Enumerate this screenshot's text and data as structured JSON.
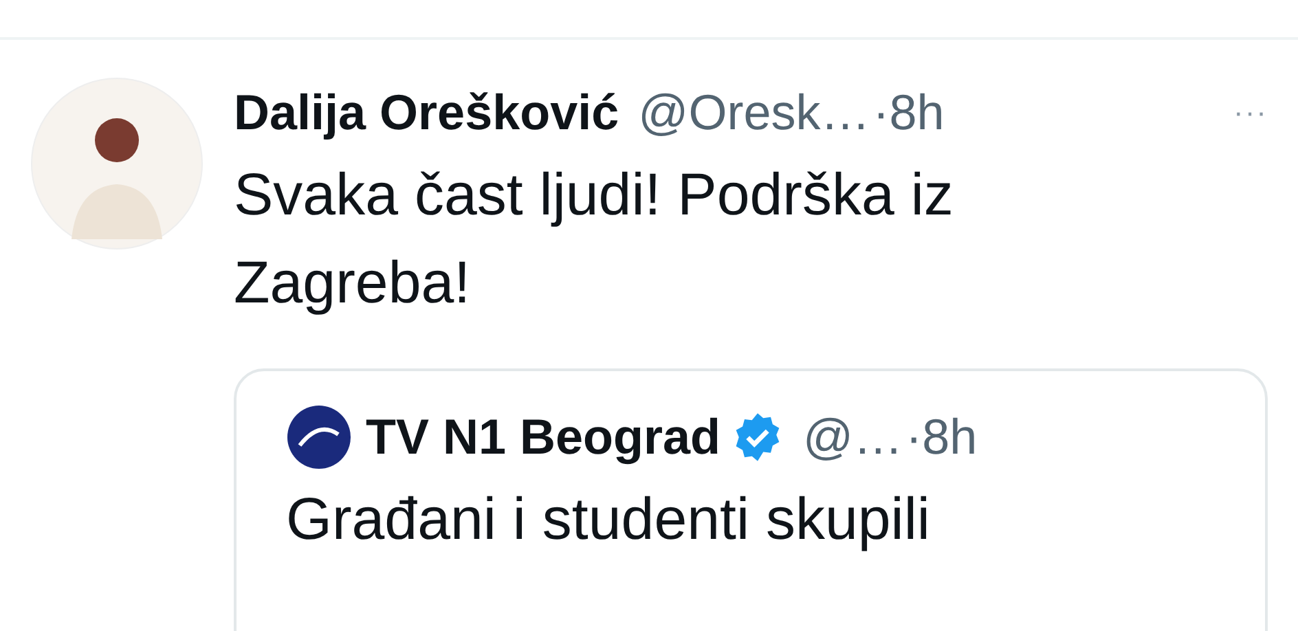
{
  "tweet": {
    "name": "Dalija Orešković",
    "handle": "@Oresk…",
    "separator": "·",
    "time": "8h",
    "more": "···",
    "text": "Svaka čast ljudi! Podrška iz Zagreba!"
  },
  "quoted": {
    "name": "TV N1 Beograd",
    "verified": true,
    "handle": "@…",
    "separator": "·",
    "time": "8h",
    "text": "Građani i studenti skupili"
  }
}
